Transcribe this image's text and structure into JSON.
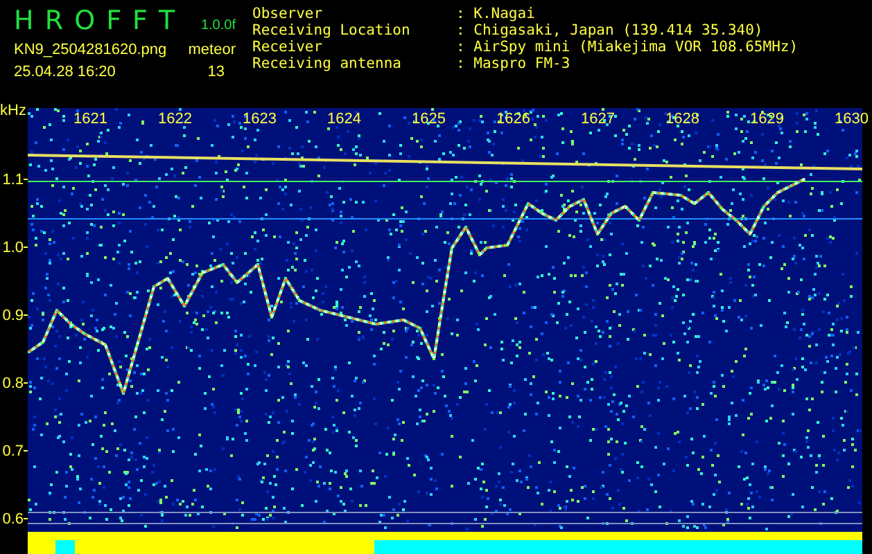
{
  "header": {
    "title": "H R O F F T",
    "version": "1.0.0f",
    "filename": "KN9_2504281620.png",
    "datetime": "25.04.28 16:20",
    "count_label": "meteor",
    "count": "13"
  },
  "info": [
    {
      "label": "Observer",
      "value": ": K.Nagai"
    },
    {
      "label": "Receiving Location",
      "value": ": Chigasaki, Japan (139.414 35.340)"
    },
    {
      "label": "Receiver",
      "value": ": AirSpy mini (Miakejima VOR 108.65MHz)"
    },
    {
      "label": "Receiving antenna",
      "value": ": Maspro FM-3"
    }
  ],
  "axis": {
    "unit": "kHz",
    "labels": [
      "1.1",
      "1.0",
      "0.9",
      "0.8",
      "0.7",
      "0.6"
    ]
  },
  "time_labels": [
    "1621",
    "1622",
    "1623",
    "1624",
    "1625",
    "1626",
    "1627",
    "1628",
    "1629",
    "1630"
  ]
}
